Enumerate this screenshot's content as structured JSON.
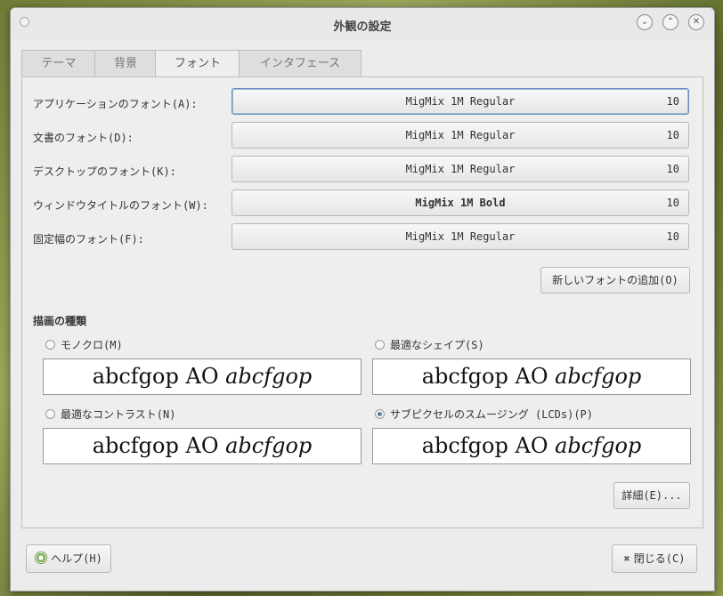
{
  "window": {
    "title": "外観の設定",
    "controls": {
      "minimize": "⌄",
      "maximize": "⌃",
      "close": "✕"
    }
  },
  "tabs": [
    "テーマ",
    "背景",
    "フォント",
    "インタフェース"
  ],
  "fonts": [
    {
      "label": "アプリケーションのフォント(A):",
      "name": "MigMix 1M Regular",
      "size": "10"
    },
    {
      "label": "文書のフォント(D):",
      "name": "MigMix 1M Regular",
      "size": "10"
    },
    {
      "label": "デスクトップのフォント(K):",
      "name": "MigMix 1M Regular",
      "size": "10"
    },
    {
      "label": "ウィンドウタイトルのフォント(W):",
      "name": "MigMix 1M Bold",
      "size": "10"
    },
    {
      "label": "固定幅のフォント(F):",
      "name": "MigMix 1M Regular",
      "size": "10"
    }
  ],
  "add_font_button": "新しいフォントの追加(O)",
  "rendering": {
    "section_title": "描画の種類",
    "options": [
      {
        "label": "モノクロ(M)",
        "selected": false,
        "sample_normal": "abcfgop AO ",
        "sample_italic": "abcfgop"
      },
      {
        "label": "最適なシェイプ(S)",
        "selected": false,
        "sample_normal": "abcfgop AO ",
        "sample_italic": "abcfgop"
      },
      {
        "label": "最適なコントラスト(N)",
        "selected": false,
        "sample_normal": "abcfgop AO ",
        "sample_italic": "abcfgop"
      },
      {
        "label": "サブピクセルのスムージング (LCDs)(P)",
        "selected": true,
        "sample_normal": "abcfgop AO ",
        "sample_italic": "abcfgop"
      }
    ]
  },
  "details_button": "詳細(E)...",
  "help_button": "ヘルプ(H)",
  "close_button": "閉じる(C)",
  "colors": {
    "accent": "#5b7fb3",
    "focus_border": "#6b8fbf"
  }
}
